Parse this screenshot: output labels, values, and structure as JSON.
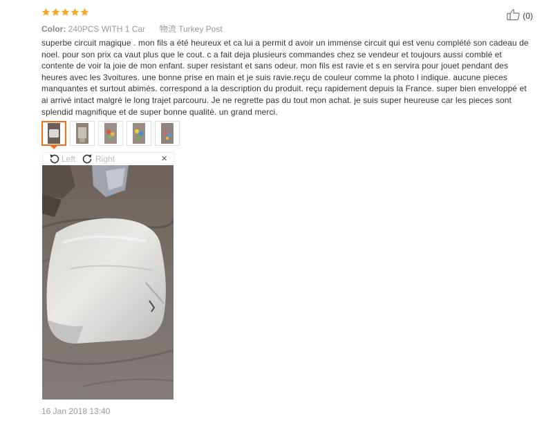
{
  "rating": {
    "stars": 5,
    "max": 5,
    "color": "#f5a623"
  },
  "meta": {
    "color_label": "Color:",
    "color_value": "240PCS WITH 1 Car",
    "shipping_label": "物流",
    "shipping_value": "Turkey Post"
  },
  "helpful": {
    "count": "(0)",
    "icon": "thumbs-up-icon"
  },
  "review_text": "superbe circuit magique . mon fils a été heureux et ca lui a permit d avoir un immense circuit qui est venu complété son cadeau de noel. pour son prix ca vaut plus que le cout. c a fait deja plusieurs commandes chez se vendeur et toujours aussi comblé et contente de voir la joie de mon enfant. super resistant et sans odeur. mon fils est ravie et s en servira pour jouet pendant des heures avec les 3voitures. une bonne prise en main et je suis ravie.reçu de couleur comme la photo l indique. aucune pieces manquantes et surtout abimés. correspond a la description du produit. reçu rapidement depuis la France. super bien enveloppé et ai arrivé intact malgré le long trajet parcouru. Je ne regrette pas du tout mon achat. je suis super heureuse car les pieces sont splendid magnifique et de super bonne qualité. un grand merci.",
  "thumbnails": [
    {
      "name": "photo-package",
      "active": true
    },
    {
      "name": "photo-box",
      "active": false
    },
    {
      "name": "photo-pieces-red",
      "active": false
    },
    {
      "name": "photo-pieces-yellow",
      "active": false
    },
    {
      "name": "photo-pieces-blue",
      "active": false
    }
  ],
  "viewer": {
    "rotate_left": "Left",
    "rotate_right": "Right",
    "close": "×"
  },
  "accent_color": "#f36d1b",
  "date": "16 Jan 2018 13:40"
}
